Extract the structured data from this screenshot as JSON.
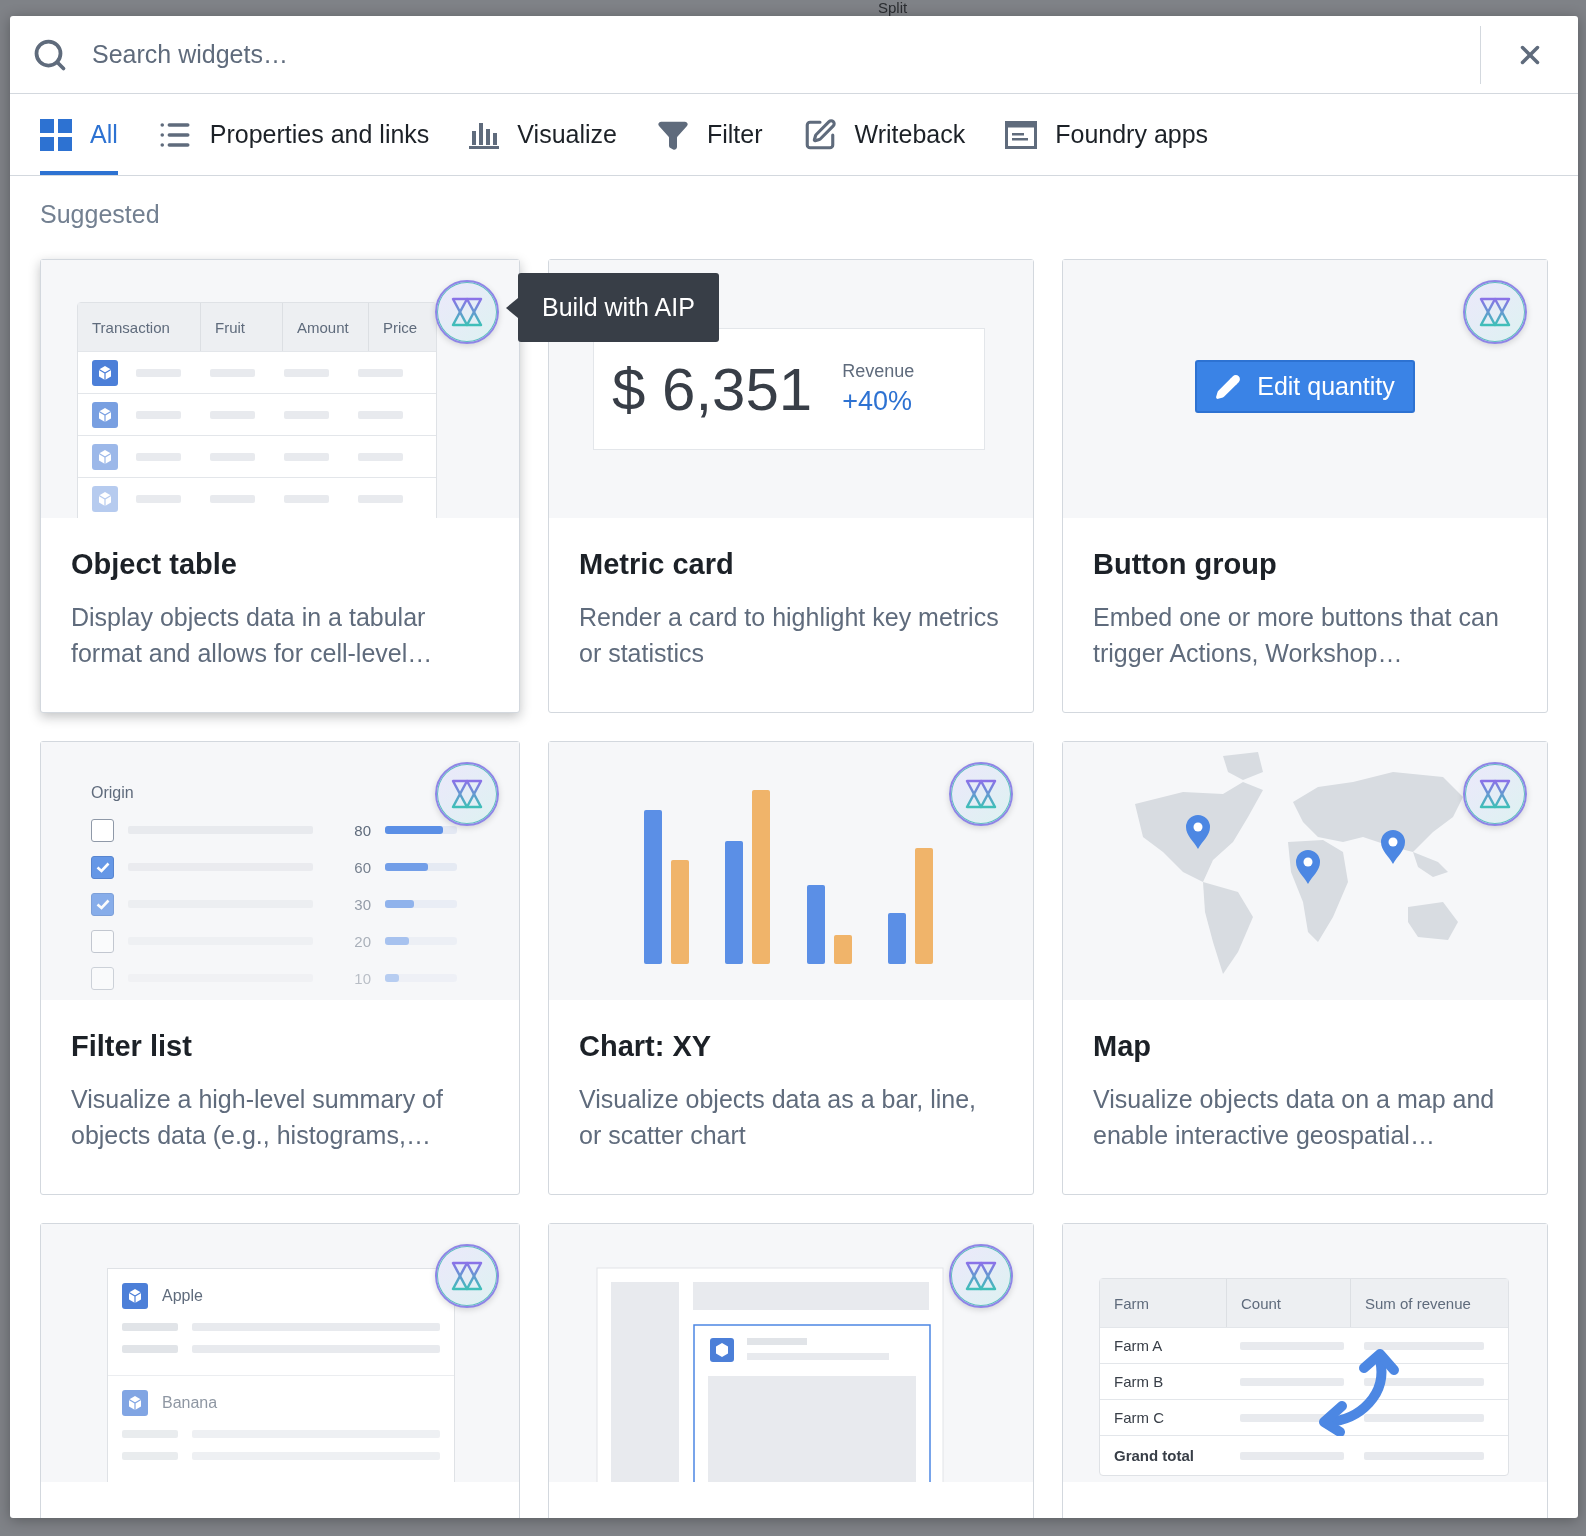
{
  "backdrop": {
    "toolbar_text": "Split"
  },
  "search": {
    "placeholder": "Search widgets…"
  },
  "tabs": [
    {
      "kind": "all",
      "label": "All",
      "selected": true
    },
    {
      "kind": "properties",
      "label": "Properties and links",
      "selected": false
    },
    {
      "kind": "visualize",
      "label": "Visualize",
      "selected": false
    },
    {
      "kind": "filter",
      "label": "Filter",
      "selected": false
    },
    {
      "kind": "writeback",
      "label": "Writeback",
      "selected": false
    },
    {
      "kind": "apps",
      "label": "Foundry apps",
      "selected": false
    }
  ],
  "section_title": "Suggested",
  "tooltip": "Build with AIP",
  "cards": [
    {
      "kind": "object_table",
      "title": "Object table",
      "description": "Display objects data in a tabular format and allows for cell-level…",
      "aip": true,
      "hovered": true,
      "preview": {
        "columns": [
          "Transaction",
          "Fruit",
          "Amount",
          "Price"
        ]
      }
    },
    {
      "kind": "metric",
      "title": "Metric card",
      "description": "Render a card to highlight key metrics or statistics",
      "aip": false,
      "hovered": false,
      "preview": {
        "value": "$ 6,351",
        "label": "Revenue",
        "change": "+40%"
      }
    },
    {
      "kind": "button",
      "title": "Button group",
      "description": "Embed one or more buttons that can trigger Actions, Workshop…",
      "aip": true,
      "hovered": false,
      "preview": {
        "button_label": "Edit quantity"
      }
    },
    {
      "kind": "filter_list",
      "title": "Filter list",
      "description": "Visualize a high-level summary of objects data (e.g., histograms,…",
      "aip": true,
      "hovered": false,
      "preview": {
        "label": "Origin",
        "rows": [
          {
            "checked": false,
            "value": "80",
            "level": 0.8
          },
          {
            "checked": true,
            "value": "60",
            "level": 0.6
          },
          {
            "checked": true,
            "value": "30",
            "level": 0.4
          },
          {
            "checked": false,
            "value": "20",
            "level": 0.33
          },
          {
            "checked": false,
            "value": "10",
            "level": 0.2
          }
        ]
      }
    },
    {
      "kind": "chart",
      "title": "Chart: XY",
      "description": "Visualize objects data as a bar, line, or scatter chart",
      "aip": true,
      "hovered": false
    },
    {
      "kind": "map",
      "title": "Map",
      "description": "Visualize objects data on a map and enable interactive geospatial…",
      "aip": true,
      "hovered": false
    },
    {
      "kind": "object_list",
      "aip": true,
      "hovered": false,
      "preview": {
        "items": [
          "Apple",
          "Banana"
        ]
      }
    },
    {
      "kind": "layout",
      "aip": true,
      "hovered": false
    },
    {
      "kind": "pivot",
      "aip": false,
      "hovered": false,
      "preview": {
        "columns": [
          "Farm",
          "Count",
          "Sum of revenue"
        ],
        "rows": [
          "Farm A",
          "Farm B",
          "Farm C"
        ],
        "total": "Grand total"
      }
    }
  ]
}
